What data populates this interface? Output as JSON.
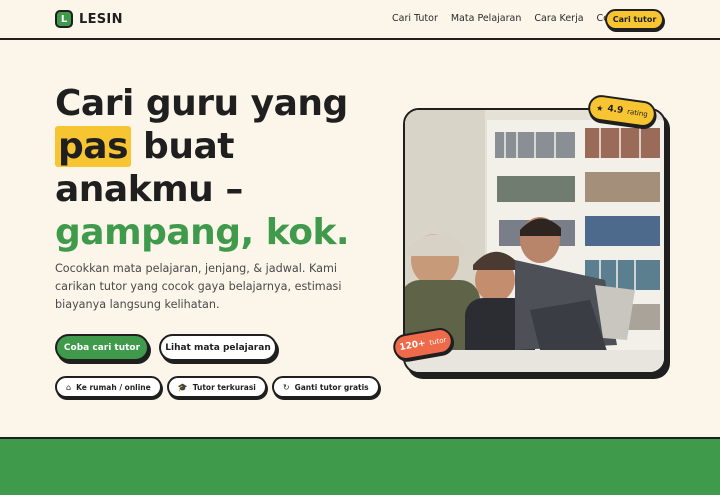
{
  "brand": {
    "logo_letter": "L",
    "name": "LESIN"
  },
  "nav": {
    "links": [
      "Cari Tutor",
      "Mata Pelajaran",
      "Cara Kerja",
      "Cerita"
    ],
    "cta": "Cari tutor"
  },
  "hero": {
    "headline_part1": "Cari guru yang",
    "headline_highlight": "pas",
    "headline_part2": "buat anakmu –",
    "headline_green": "gampang, kok.",
    "subtext": "Cocokkan mata pelajaran, jenjang, & jadwal. Kami carikan tutor yang cocok gaya belajarnya, estimasi biayanya langsung kelihatan.",
    "primary_button": "Coba cari tutor",
    "secondary_button": "Lihat mata pelajaran",
    "chips": [
      {
        "icon": "home-icon",
        "glyph": "⌂",
        "label": "Ke rumah / online"
      },
      {
        "icon": "graduation-cap-icon",
        "glyph": "🎓",
        "label": "Tutor terkurasi"
      },
      {
        "icon": "refresh-icon",
        "glyph": "↻",
        "label": "Ganti tutor gratis"
      }
    ]
  },
  "badges": {
    "rating_icon": "★",
    "rating_value": "4.9",
    "rating_label": "rating",
    "tutors_value": "120+",
    "tutors_label": "tutor"
  },
  "colors": {
    "accent_green": "#3f9a4b",
    "accent_yellow": "#f6c531",
    "accent_orange": "#ef6a4a",
    "background": "#fbf5ea"
  }
}
